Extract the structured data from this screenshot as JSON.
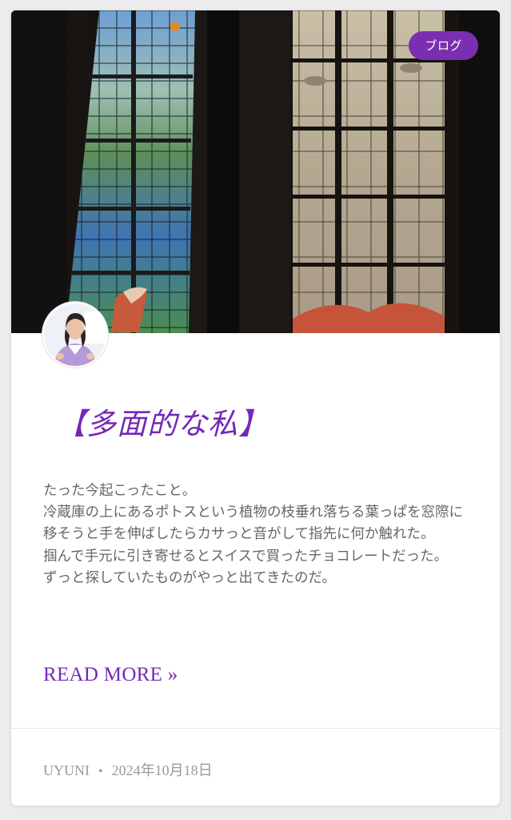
{
  "post": {
    "category": "ブログ",
    "title": "【多面的な私】",
    "excerpt": [
      "たった今起こったこと。",
      "冷蔵庫の上にあるポトスという植物の枝垂れ落ちる葉っぱを窓際に移そうと手を伸ばしたらカサっと音がして指先に何か触れた。",
      "掴んで手元に引き寄せるとスイスで買ったチョコレートだった。",
      "ずっと探していたものがやっと出てきたのだ。"
    ],
    "read_more": "READ MORE »",
    "author": "UYUNI",
    "separator": "•",
    "date": "2024年10月18日"
  },
  "icons": {
    "avatar": "author-avatar-photo",
    "hero": "stained-glass-window-photo"
  }
}
